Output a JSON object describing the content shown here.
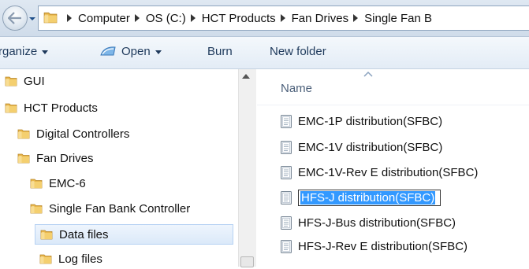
{
  "address": {
    "crumbs": [
      "Computer",
      "OS (C:)",
      "HCT Products",
      "Fan Drives",
      "Single Fan B"
    ]
  },
  "toolbar": {
    "organize": "rganize",
    "open": "Open",
    "burn": "Burn",
    "new_folder": "New folder"
  },
  "nav": {
    "items": [
      {
        "label": "GUI"
      },
      {
        "label": "HCT Products"
      },
      {
        "label": "Digital Controllers"
      },
      {
        "label": "Fan Drives"
      },
      {
        "label": "EMC-6"
      },
      {
        "label": "Single Fan Bank Controller"
      },
      {
        "label": "Data files"
      },
      {
        "label": "Log files"
      }
    ]
  },
  "content": {
    "column_name": "Name",
    "files": [
      {
        "name": "EMC-1P distribution(SFBC)"
      },
      {
        "name": "EMC-1V distribution(SFBC)"
      },
      {
        "name": "EMC-1V-Rev E distribution(SFBC)"
      },
      {
        "name": "HFS-J distribution(SFBC)"
      },
      {
        "name": "HFS-J-Bus distribution(SFBC)"
      },
      {
        "name": "HFS-J-Rev E distribution(SFBC)"
      }
    ]
  },
  "colors": {
    "folder": "#e8b64a",
    "selection": "#3399ff",
    "toolbar_text": "#1e395b"
  }
}
